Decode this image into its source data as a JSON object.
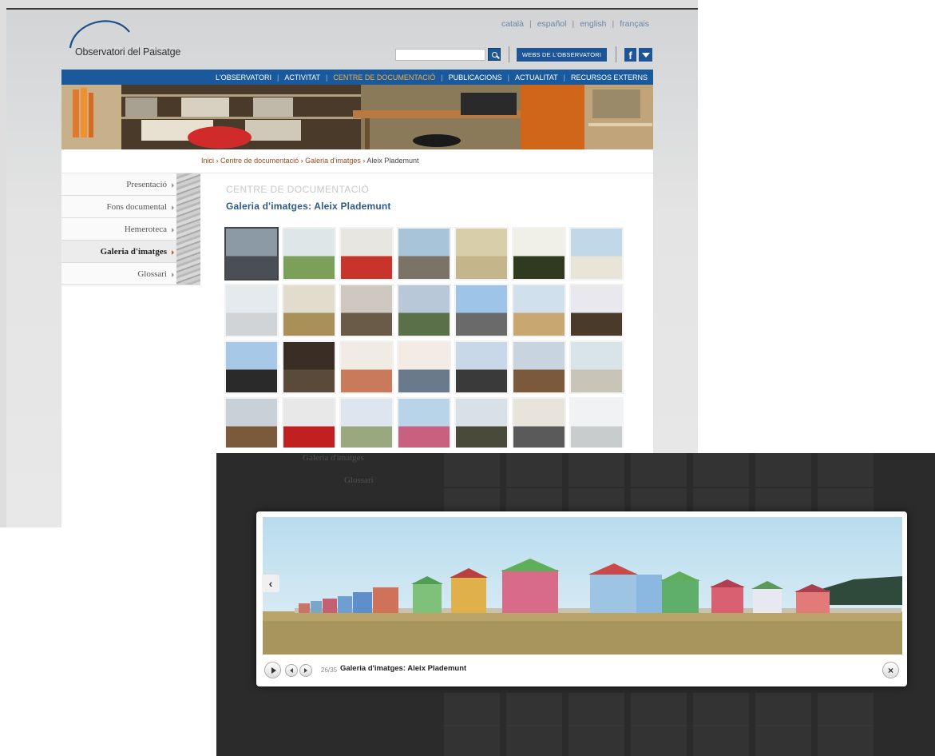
{
  "header": {
    "logo_text": "Observatori del Paisatge",
    "languages": [
      "català",
      "español",
      "english",
      "français"
    ],
    "search_placeholder": "",
    "webs_button": "WEBS DE L'OBSERVATORI",
    "facebook_glyph": "f"
  },
  "nav": {
    "items": [
      "L'OBSERVATORI",
      "ACTIVITAT",
      "CENTRE DE DOCUMENTACIÓ",
      "PUBLICACIONS",
      "ACTUALITAT",
      "RECURSOS EXTERNS"
    ],
    "active_index": 2,
    "active_color": "#f0b142",
    "bar_color": "#1a5a9c"
  },
  "breadcrumb": {
    "items": [
      "Inici",
      "Centre de documentació",
      "Galeria d'imatges"
    ],
    "current": "Aleix Plademunt",
    "separator": "›"
  },
  "sidebar": {
    "items": [
      {
        "label": "Presentació",
        "active": false
      },
      {
        "label": "Fons documental",
        "active": false
      },
      {
        "label": "Hemeroteca",
        "active": false
      },
      {
        "label": "Galeria d'imatges",
        "active": true
      },
      {
        "label": "Glossari",
        "active": false
      }
    ]
  },
  "main": {
    "section_heading": "CENTRE DE DOCUMENTACIÓ",
    "gallery_title": "Galeria d'imatges: Aleix Plademunt",
    "selected_thumb": 0
  },
  "lightbox_view": {
    "background_menu": [
      "Galeria d'imatges",
      "Glossari"
    ],
    "counter": "26/35",
    "caption": "Galeria d'imatges: Aleix Plademunt",
    "prev_glyph": "‹",
    "close_glyph": "×"
  },
  "icons": {
    "search": "search-icon",
    "facebook": "facebook-icon",
    "twitter": "twitter-icon",
    "play": "play-icon",
    "prev": "prev-icon",
    "next": "next-icon",
    "close": "close-icon"
  }
}
